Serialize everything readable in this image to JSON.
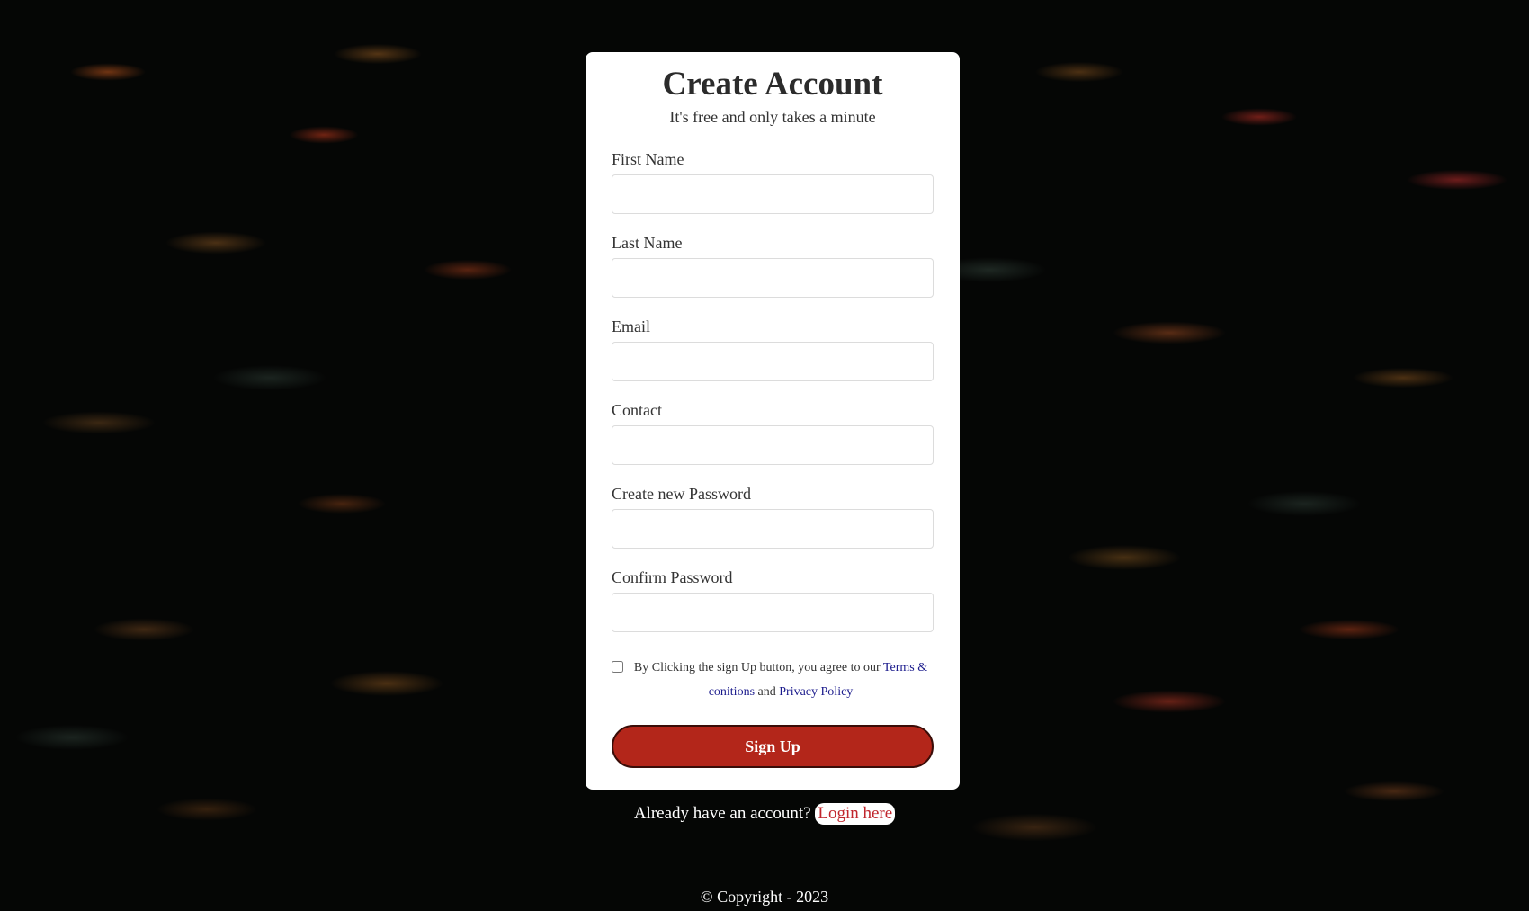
{
  "form": {
    "title": "Create Account",
    "subtitle": "It's free and only takes a minute",
    "fields": [
      {
        "label": "First Name",
        "value": ""
      },
      {
        "label": "Last Name",
        "value": ""
      },
      {
        "label": "Email",
        "value": ""
      },
      {
        "label": "Contact",
        "value": ""
      },
      {
        "label": "Create new Password",
        "value": ""
      },
      {
        "label": "Confirm Password",
        "value": ""
      }
    ],
    "agreement": {
      "checked": false,
      "text_before": "By Clicking the sign Up button, you agree to our",
      "terms_link": "Terms & conitions",
      "text_and": "and",
      "privacy_link": "Privacy Policy"
    },
    "signup_button": "Sign Up"
  },
  "login": {
    "prompt": "Already have an account?",
    "link": "Login here"
  },
  "footer": {
    "copyright": "© Copyright - 2023"
  },
  "colors": {
    "button_bg": "#b3261a",
    "login_link": "#c0262d",
    "policy_link": "#1a1a8c"
  }
}
